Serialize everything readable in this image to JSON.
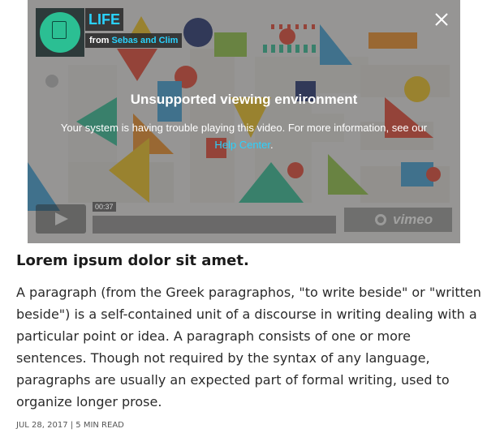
{
  "video": {
    "title": "LIFE",
    "from_prefix": "from",
    "author": "Sebas and Clim",
    "error_title": "Unsupported viewing environment",
    "error_text": "Your system is having trouble playing this video. For more information, see our",
    "help_link": "Help Center",
    "help_suffix": ".",
    "timecode": "00:37",
    "brand": "vimeo"
  },
  "article": {
    "headline": "Lorem ipsum dolor sit amet.",
    "paragraph": "A paragraph (from the Greek paragraphos, \"to write beside\" or \"written beside\") is a self-contained unit of a discourse in writing dealing with a particular point or idea. A paragraph consists of one or more sentences. Though not required by the syntax of any language, paragraphs are usually an expected part of formal writing, used to organize longer prose.",
    "meta": "JUL 28, 2017 | 5 MIN READ"
  },
  "colors": {
    "accent": "#2ad2ff",
    "logo_green": "#2bbf93"
  }
}
